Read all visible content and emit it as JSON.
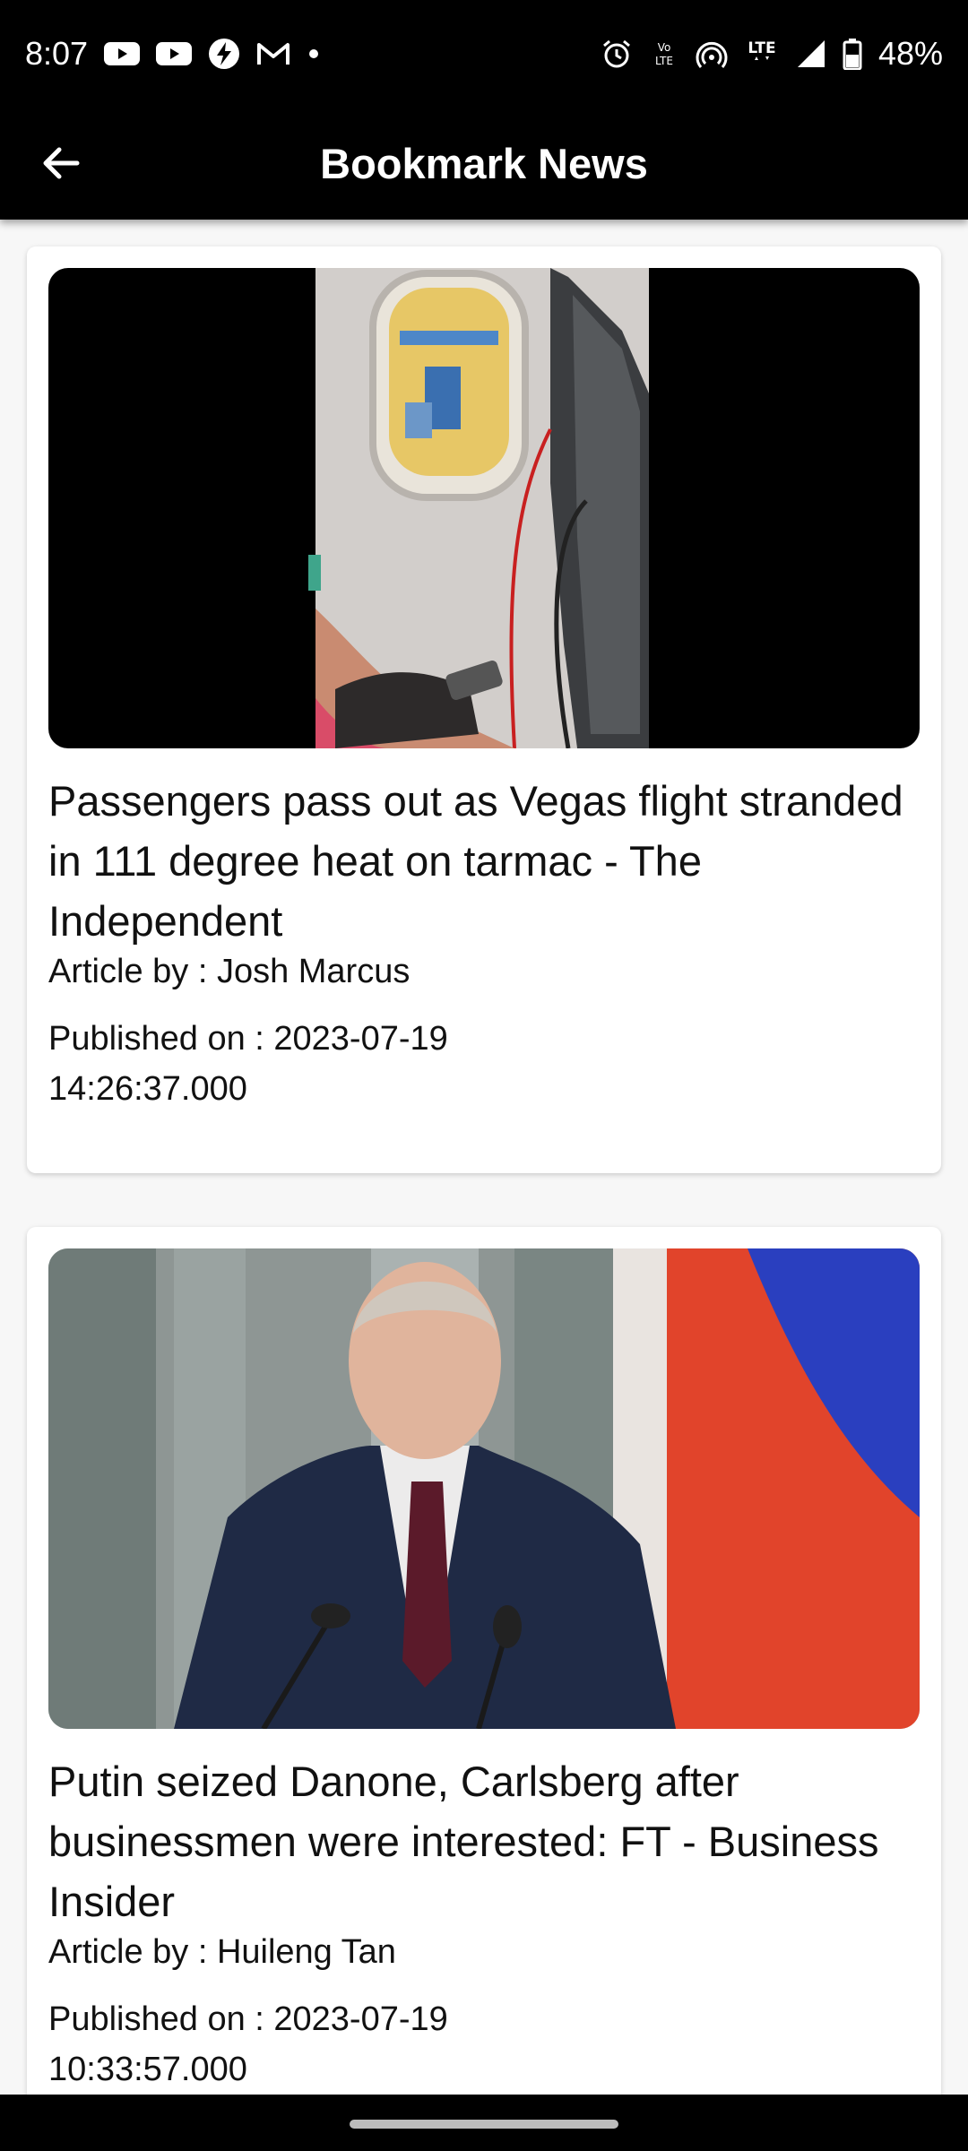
{
  "status_bar": {
    "time": "8:07",
    "battery": "48%",
    "icons": [
      "youtube-icon",
      "youtube-icon",
      "bolt-icon",
      "gmail-icon",
      "dot-icon",
      "alarm-icon",
      "volte-icon",
      "hotspot-icon",
      "lte-icon",
      "signal-icon",
      "battery-icon"
    ]
  },
  "app_bar": {
    "title": "Bookmark News",
    "back_icon": "arrow-left-icon"
  },
  "articles": [
    {
      "title": "Passengers pass out as Vegas flight stranded in 111 degree heat on tarmac - The Independent",
      "author": "Article by : Josh Marcus",
      "published": "Published on : 2023-07-19 14:26:37.000",
      "image_desc": "airplane-window-photo"
    },
    {
      "title": "Putin seized Danone, Carlsberg after businessmen were interested: FT - Business Insider",
      "author": "Article by : Huileng Tan",
      "published": "Published on : 2023-07-19 10:33:57.000",
      "image_desc": "putin-portrait-photo"
    }
  ],
  "colors": {
    "app_bar": "#000000",
    "background": "#f7f7f7",
    "card": "#ffffff",
    "text": "#111111"
  }
}
